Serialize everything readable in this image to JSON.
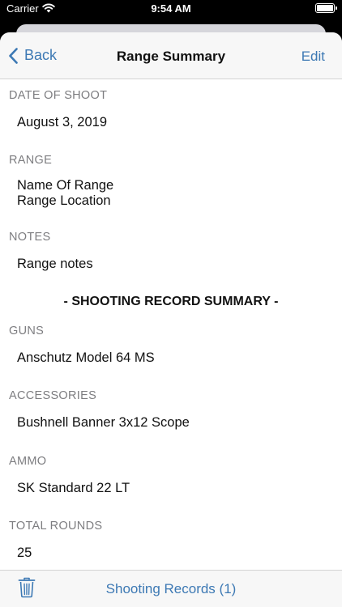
{
  "status": {
    "carrier": "Carrier",
    "time": "9:54 AM"
  },
  "nav": {
    "back_label": "Back",
    "title": "Range Summary",
    "edit_label": "Edit"
  },
  "date": {
    "label": "DATE OF SHOOT",
    "value": "August 3, 2019"
  },
  "range": {
    "label": "RANGE",
    "name": "Name Of Range",
    "location": "Range Location"
  },
  "notes": {
    "label": "NOTES",
    "value": "Range notes"
  },
  "summary_heading": "- SHOOTING RECORD SUMMARY -",
  "guns": {
    "label": "GUNS",
    "value": "Anschutz Model 64 MS"
  },
  "accessories": {
    "label": "ACCESSORIES",
    "value": "Bushnell Banner 3x12 Scope"
  },
  "ammo": {
    "label": "AMMO",
    "value": "SK Standard 22 LT"
  },
  "total_rounds": {
    "label": "TOTAL ROUNDS",
    "value": "25"
  },
  "toolbar": {
    "records_label": "Shooting Records (1)",
    "trash_icon": "trash-icon"
  },
  "colors": {
    "accent": "#3d79b4",
    "label_gray": "#7d7d80",
    "bar_bg": "#f7f7f7"
  }
}
